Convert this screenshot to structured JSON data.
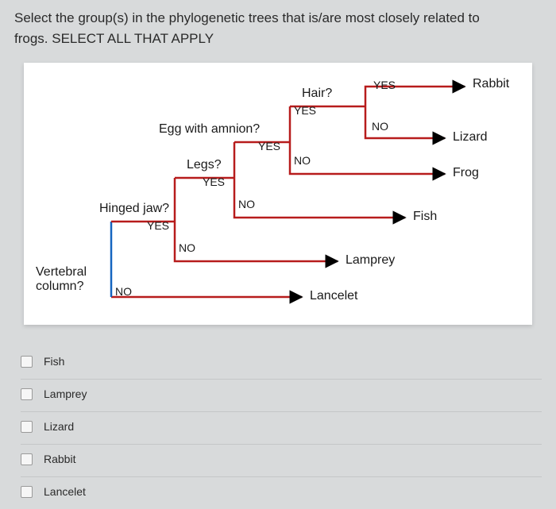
{
  "question": {
    "prompt_line1": "Select the group(s) in the phylogenetic trees that is/are most closely related to",
    "prompt_line2": "frogs. SELECT ALL THAT APPLY"
  },
  "tree": {
    "nodes": {
      "vertebral_label": "Vertebral",
      "column_label": "column?",
      "hinged_jaw": "Hinged jaw?",
      "legs": "Legs?",
      "egg_amnion": "Egg with amnion?",
      "hair": "Hair?"
    },
    "branches": {
      "yes": "YES",
      "no": "NO"
    },
    "taxa": {
      "rabbit": "Rabbit",
      "lizard": "Lizard",
      "frog": "Frog",
      "fish": "Fish",
      "lamprey": "Lamprey",
      "lancelet": "Lancelet"
    }
  },
  "answers": [
    {
      "label": "Fish"
    },
    {
      "label": "Lamprey"
    },
    {
      "label": "Lizard"
    },
    {
      "label": "Rabbit"
    },
    {
      "label": "Lancelet"
    }
  ]
}
